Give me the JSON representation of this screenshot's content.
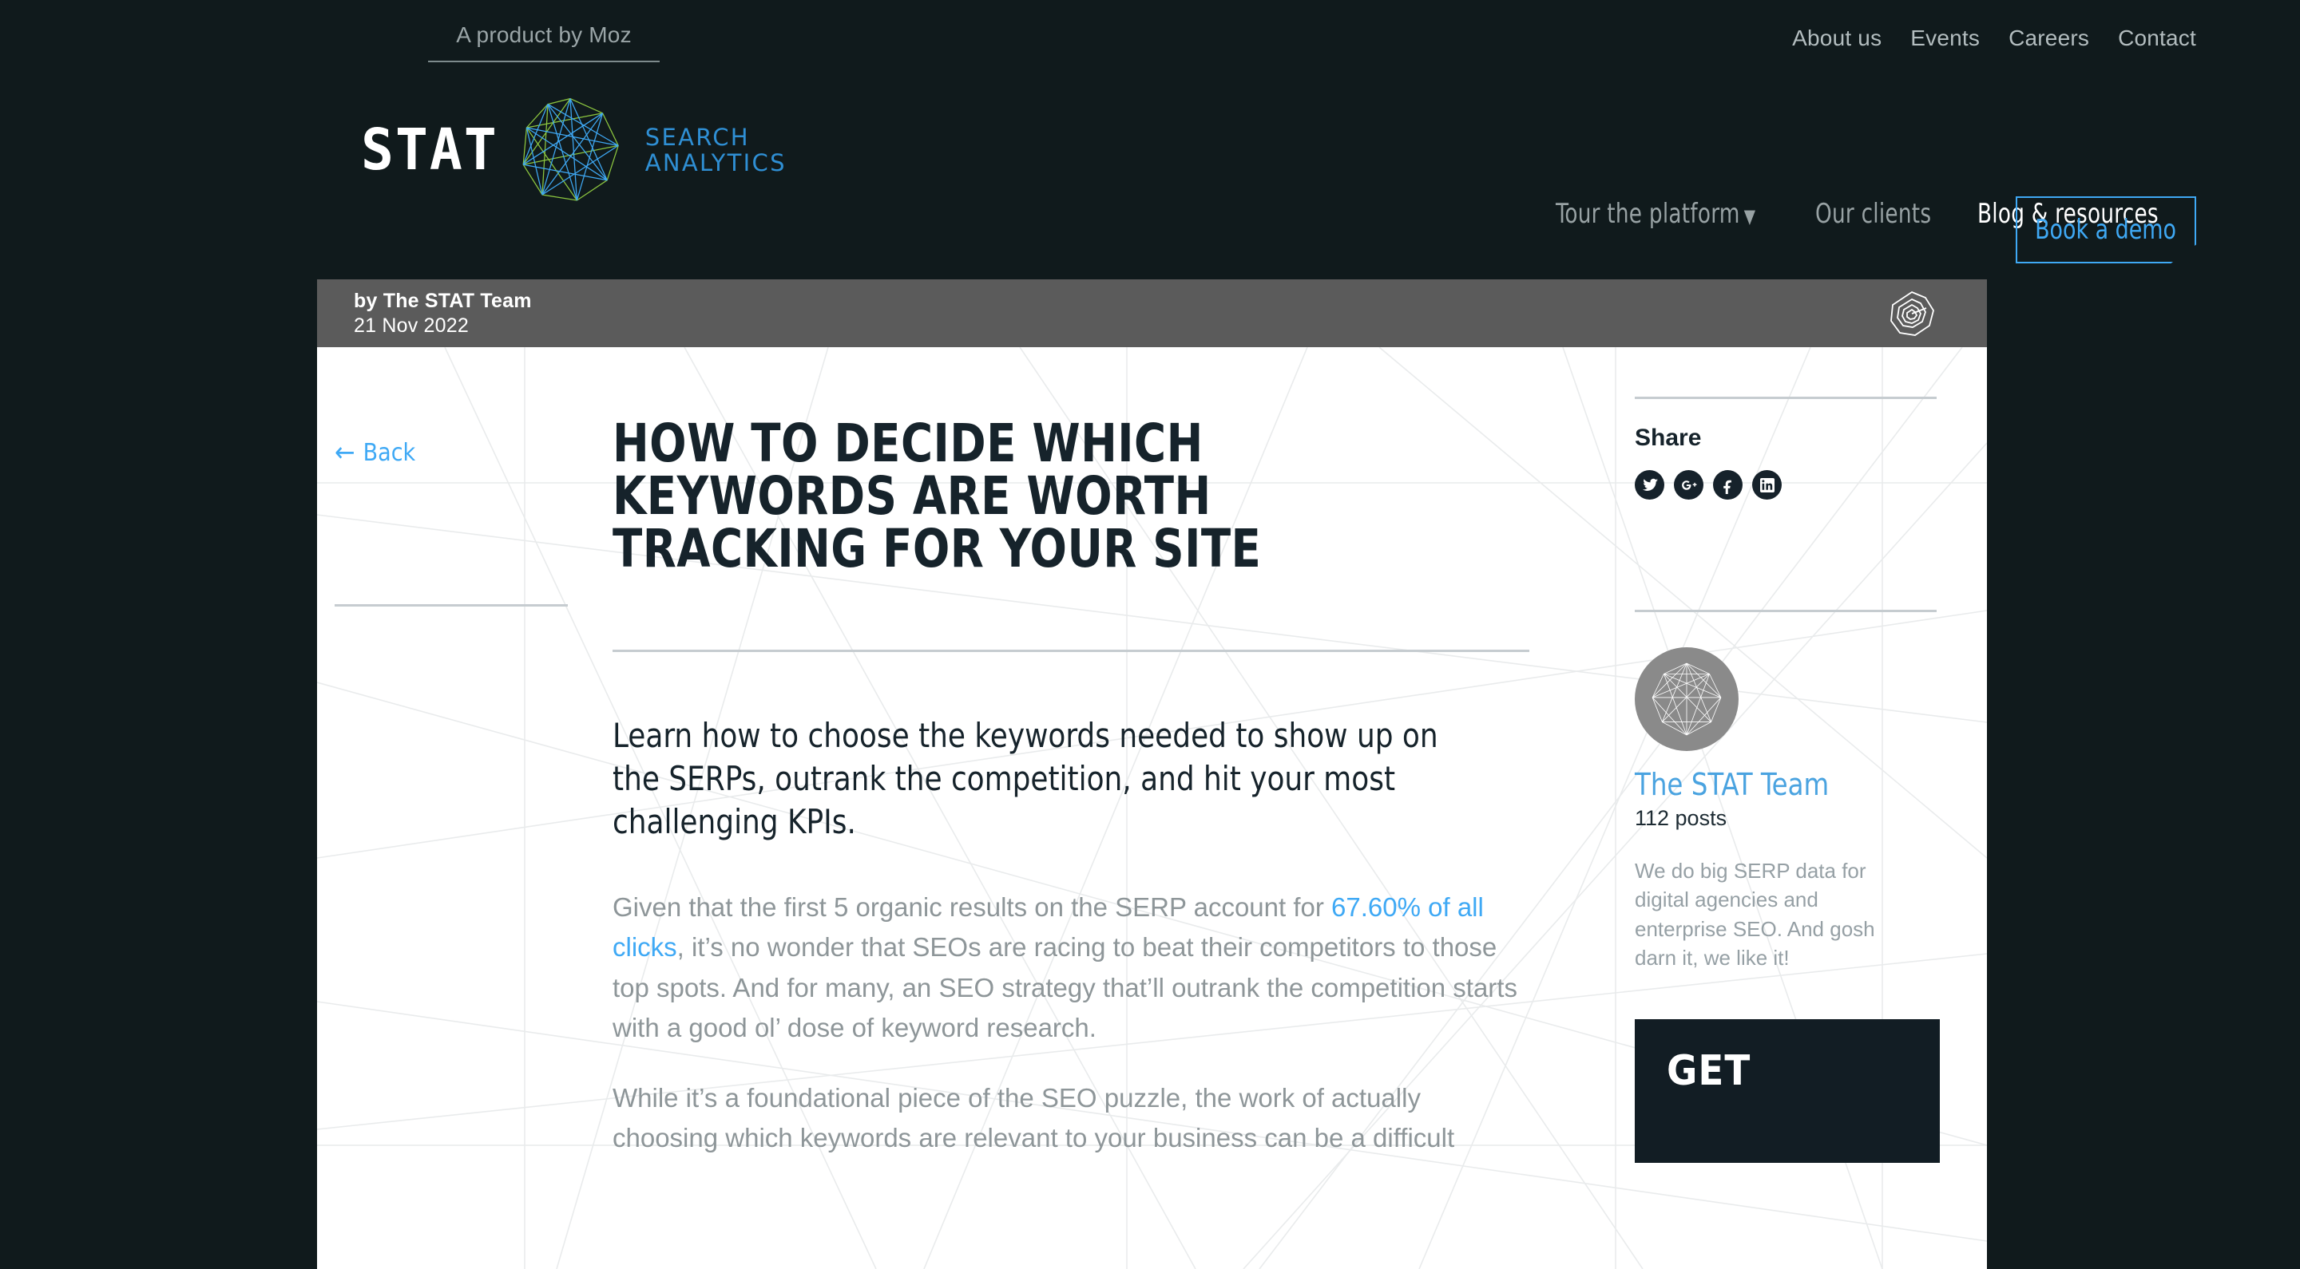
{
  "topbar": {
    "product_by": "A product by Moz",
    "links": [
      {
        "label": "About us"
      },
      {
        "label": "Events"
      },
      {
        "label": "Careers"
      },
      {
        "label": "Contact"
      }
    ]
  },
  "brand": {
    "wordmark": "STAT",
    "sub_line1": "SEARCH",
    "sub_line2": "ANALYTICS",
    "logo_icon": "network-polygon-icon",
    "accent_blue": "#3fa9f5",
    "accent_green": "#8cc63f",
    "dark_bg": "#101a1c"
  },
  "mainnav": {
    "items": [
      {
        "label": "Tour the platform",
        "active": false,
        "has_caret": true
      },
      {
        "label": "Our clients",
        "active": false,
        "has_caret": false
      },
      {
        "label": "Blog & resources",
        "active": true,
        "has_caret": false
      }
    ],
    "cta_label": "Book a demo"
  },
  "article": {
    "byline": "by The STAT Team",
    "date": "21 Nov 2022",
    "header_icon": "stat-target-spiral-icon",
    "back_label": "Back",
    "back_arrow": "←",
    "title": "How to decide which keywords are worth tracking for your site",
    "lede": "Learn how to choose the keywords needed to show up on the SERPs, outrank the competition, and hit your most challenging KPIs.",
    "paragraphs": [
      {
        "before": "Given that the first 5 organic results on the SERP account for ",
        "link": "67.60% of all clicks",
        "after": ", it’s no wonder that SEOs are racing to beat their competitors to those top spots. And for many, an SEO strategy that’ll outrank the competition starts with a good ol’ dose of keyword research."
      },
      {
        "before": "While it’s a foundational piece of the SEO puzzle, the work of actually choosing which keywords are relevant to your business can be a difficult",
        "link": "",
        "after": ""
      }
    ]
  },
  "sidebar": {
    "share_title": "Share",
    "share_buttons": [
      {
        "name": "twitter-icon",
        "label": "Twitter"
      },
      {
        "name": "google-plus-icon",
        "label": "Google Plus"
      },
      {
        "name": "facebook-icon",
        "label": "Facebook"
      },
      {
        "name": "linkedin-icon",
        "label": "LinkedIn"
      }
    ],
    "author": {
      "avatar_icon": "network-polygon-avatar-icon",
      "name": "The STAT Team",
      "posts": "112 posts",
      "bio": "We do big SERP data for digital agencies and enterprise SEO. And gosh darn it, we like it!"
    },
    "cta": {
      "text": "GET"
    }
  }
}
